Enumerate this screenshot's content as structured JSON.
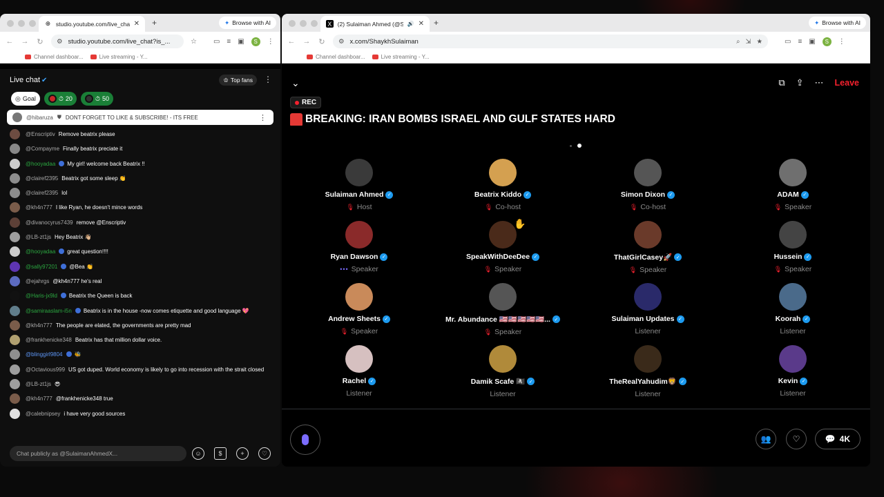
{
  "left_window": {
    "tab_title": "studio.youtube.com/live_chat",
    "browse_ai": "Browse with AI",
    "url": "studio.youtube.com/live_chat?is_...",
    "bookmarks": [
      "Channel dashboar...",
      "Live streaming - Y..."
    ],
    "chat": {
      "title": "Live chat",
      "top_fans": "Top fans",
      "chips": [
        {
          "label": "Goal"
        },
        {
          "label": "20"
        },
        {
          "label": "50"
        }
      ],
      "pinned": {
        "author": "@hibaruza",
        "text": "DONT FORGET TO LIKE & SUBSCRIBE! - ITS FREE"
      },
      "messages": [
        {
          "author": "@Enscriptiv",
          "text": "Remove beatrix please",
          "style": "",
          "color": "#6d4c41"
        },
        {
          "author": "@Compayme",
          "text": "Finally beatrix preciate it",
          "style": "",
          "color": "#888888"
        },
        {
          "author": "@hooyadaa",
          "text": "My girl! welcome back Beatrix !!",
          "style": "member",
          "color": "#cccccc"
        },
        {
          "author": "@clairef2395",
          "text": "Beatrix got some sleep 👏",
          "style": "",
          "color": "#8d8d8d"
        },
        {
          "author": "@clairef2395",
          "text": "lol",
          "style": "",
          "color": "#8d8d8d"
        },
        {
          "author": "@kh4n777",
          "text": "I like Ryan, he doesn't mince words",
          "style": "",
          "color": "#7a5c4a"
        },
        {
          "author": "@divanocyrus7439",
          "text": "remove @Enscriptiv",
          "style": "",
          "color": "#5d4037"
        },
        {
          "author": "@LB-zt1js",
          "text": "Hey Beatrix 👋🏼",
          "style": "",
          "color": "#9e9e9e"
        },
        {
          "author": "@hooyadaa",
          "text": "great question!!!!",
          "style": "member",
          "color": "#cccccc"
        },
        {
          "author": "@sally97201",
          "text": "@Bea 👏",
          "style": "member",
          "color": "#5e35b1"
        },
        {
          "author": "@ejahrgs",
          "text": "@kh4n777 he's real",
          "style": "",
          "color": "#5c6bc0"
        },
        {
          "author": "@Haris-jx9ld",
          "text": "Beatrix the Queen is back",
          "style": "member",
          "color": "#111111"
        },
        {
          "author": "@samiraaslam-i5n",
          "text": "Beatrix is in the house -now comes etiquette and good language 💖",
          "style": "member",
          "color": "#607d8b"
        },
        {
          "author": "@kh4n777",
          "text": "The people are elated, the governments are pretty mad",
          "style": "",
          "color": "#7a5c4a"
        },
        {
          "author": "@frankhenicke348",
          "text": "Beatrix has that million dollar voice.",
          "style": "",
          "color": "#b0a070"
        },
        {
          "author": "@blinggirl9804",
          "text": "🐝",
          "style": "blue",
          "color": "#8e8e8e"
        },
        {
          "author": "@Octavious999",
          "text": "US got duped. World economy is likely to go into recession with the strait closed",
          "style": "",
          "color": "#9e9e9e"
        },
        {
          "author": "@LB-zt1js",
          "text": "😎",
          "style": "",
          "color": "#9e9e9e"
        },
        {
          "author": "@kh4n777",
          "text": "@frankhenicke348 true",
          "style": "",
          "color": "#7a5c4a"
        },
        {
          "author": "@calebnipsey",
          "text": "i have very good sources",
          "style": "",
          "color": "#e0e0e0"
        }
      ],
      "input_placeholder": "Chat publicly as @SulaimanAhmedX..."
    }
  },
  "right_window": {
    "tab_title": "(2) Sulaiman Ahmed (@Sl",
    "browse_ai": "Browse with AI",
    "url": "x.com/ShaykhSulaiman",
    "bookmarks": [
      "Channel dashboar...",
      "Live streaming - Y..."
    ],
    "space": {
      "leave": "Leave",
      "rec": "REC",
      "title": "BREAKING: IRAN BOMBS ISRAEL AND GULF STATES HARD",
      "participants": [
        {
          "name": "Sulaiman Ahmed",
          "role": "Host",
          "status": "muted",
          "color": "#3a3a3a"
        },
        {
          "name": "Beatrix Kiddo",
          "role": "Co-host",
          "status": "muted",
          "color": "#d4a050"
        },
        {
          "name": "Simon Dixon",
          "role": "Co-host",
          "status": "muted",
          "color": "#555555"
        },
        {
          "name": "ADAM",
          "role": "Speaker",
          "status": "muted",
          "color": "#6f6f6f"
        },
        {
          "name": "Ryan Dawson",
          "role": "Speaker",
          "status": "speaking",
          "color": "#8a2a2a"
        },
        {
          "name": "SpeakWithDeeDee",
          "role": "Speaker",
          "status": "muted",
          "color": "#4a2a1a"
        },
        {
          "name": "ThatGirlCasey🚀",
          "role": "Speaker",
          "status": "muted",
          "color": "#6a3a2a"
        },
        {
          "name": "Hussein",
          "role": "Speaker",
          "status": "muted",
          "color": "#444444"
        },
        {
          "name": "Andrew Sheets",
          "role": "Speaker",
          "status": "muted",
          "color": "#c98a5a"
        },
        {
          "name": "Mr. Abundance 🇺🇸🇺🇸🇺🇸🇺🇸🇺🇸...",
          "role": "Speaker",
          "status": "muted",
          "color": "#555555"
        },
        {
          "name": "Sulaiman Updates",
          "role": "Listener",
          "status": "",
          "color": "#2a2a6a"
        },
        {
          "name": "Koorah",
          "role": "Listener",
          "status": "",
          "color": "#4a6a8a"
        },
        {
          "name": "Rachel",
          "role": "Listener",
          "status": "",
          "color": "#d6c0c0"
        },
        {
          "name": "Damik Scafe 🏴‍☠️",
          "role": "Listener",
          "status": "",
          "color": "#b08a3a"
        },
        {
          "name": "TheRealYahudim🦁",
          "role": "Listener",
          "status": "",
          "color": "#3a2a1a"
        },
        {
          "name": "Kevin",
          "role": "Listener",
          "status": "",
          "color": "#5a3a8a"
        }
      ],
      "reply_count": "4K"
    }
  }
}
